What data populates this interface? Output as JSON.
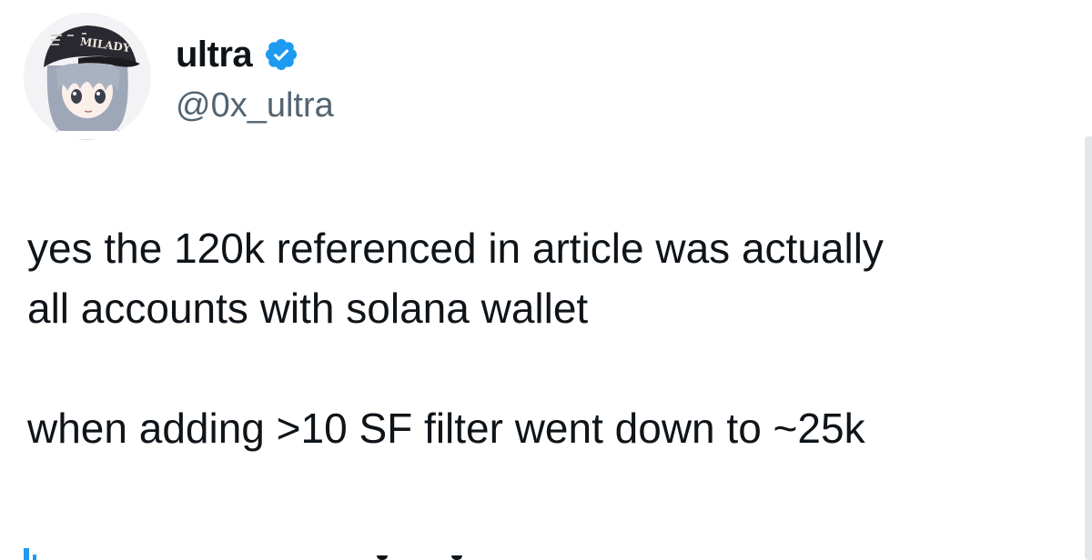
{
  "author": {
    "display_name": "ultra",
    "handle": "@0x_ultra",
    "verified": true,
    "avatar_icon": "anime-girl-avatar-icon",
    "avatar_cap_text": "MILADY"
  },
  "tweet": {
    "paragraph_1_line_1": "yes the 120k referenced in article was actually",
    "paragraph_1_line_2": "all accounts with solana wallet",
    "paragraph_2": "when adding >10 SF filter went down to ~25k"
  },
  "colors": {
    "text": "#0f1419",
    "secondary_text": "#536471",
    "verified_badge": "#1d9bf0",
    "background": "#ffffff"
  }
}
